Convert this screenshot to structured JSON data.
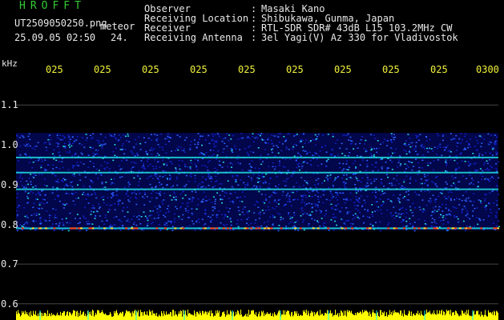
{
  "header": {
    "app_name": "HROFFT",
    "filename": "UT2509050250.png",
    "mode": "meteor",
    "datetime": "25.09.05 02:50",
    "counter": "24.",
    "info": [
      {
        "label": "Observer",
        "sep": ":",
        "value": "Masaki Kano"
      },
      {
        "label": "Receiving Location",
        "sep": ":",
        "value": "Shibukawa, Gunma, Japan"
      },
      {
        "label": "Receiver",
        "sep": ":",
        "value": "RTL-SDR SDR# 43dB L15 103.2MHz CW"
      },
      {
        "label": "Receiving Antenna",
        "sep": ":",
        "value": "3el Yagi(V) Az 330 for Vladivostok"
      }
    ]
  },
  "axis": {
    "unit": "kHz",
    "time_labels": [
      "025",
      "025",
      "025",
      "025",
      "025",
      "025",
      "025",
      "025",
      "025",
      "0300"
    ],
    "freq_labels": [
      "1.1",
      "1.0",
      "0.9",
      "0.8",
      "0.7",
      "0.6"
    ]
  },
  "spectrogram": {
    "freq_range_khz": [
      0.785,
      1.03
    ],
    "strong_lines_khz": [
      0.968,
      0.93,
      0.888,
      0.79
    ],
    "colors": {
      "background": "#000000",
      "noise": "#1020c0",
      "signal": "#20e0e0",
      "peak": "#ff4010",
      "grid": "#c8c8c8",
      "level": "#ffff00",
      "level_tick": "#00ffff"
    }
  }
}
